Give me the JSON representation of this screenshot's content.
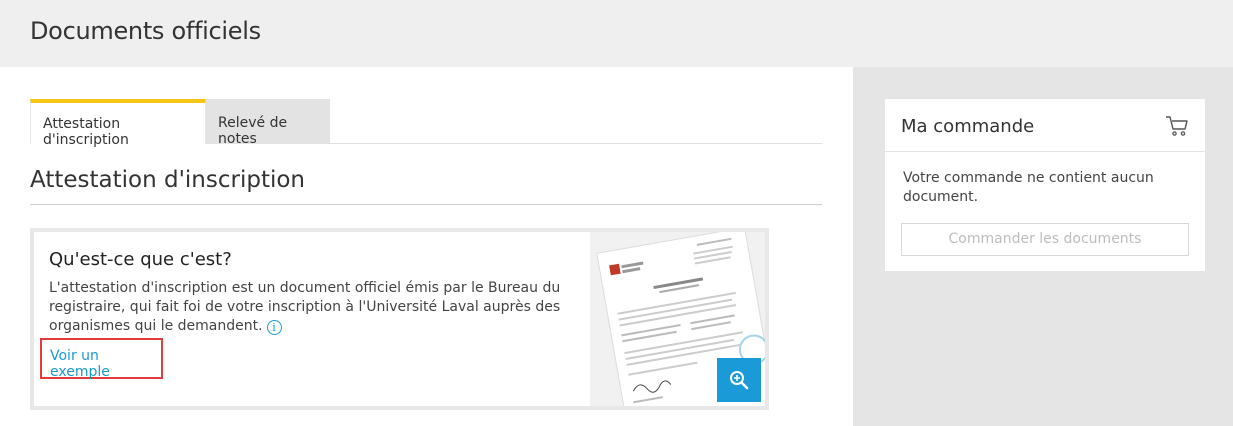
{
  "header": {
    "title": "Documents officiels"
  },
  "tabs": [
    {
      "label": "Attestation d'inscription",
      "active": true
    },
    {
      "label": "Relevé de notes",
      "active": false
    }
  ],
  "section": {
    "title": "Attestation d'inscription"
  },
  "info": {
    "heading": "Qu'est-ce que c'est?",
    "description": "L'attestation d'inscription est un document officiel émis par le Bureau du registraire, qui fait foi de votre inscription à l'Université Laval auprès des organismes qui le demandent.",
    "info_icon": "info-icon",
    "example_link": "Voir un exemple",
    "zoom_icon": "zoom-in-icon"
  },
  "order": {
    "title": "Ma commande",
    "cart_icon": "cart-icon",
    "empty_message": "Votre commande ne contient aucun document.",
    "button_label": "Commander les documents"
  },
  "colors": {
    "accent": "#f5c518",
    "link": "#1a9ad6",
    "highlight": "#e23b3b"
  }
}
